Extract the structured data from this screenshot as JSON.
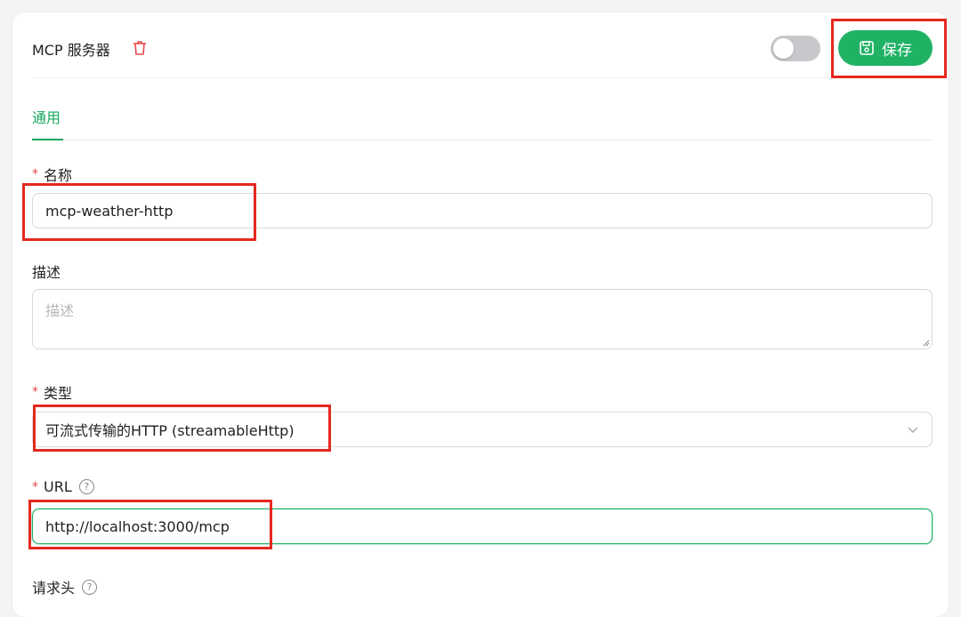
{
  "header": {
    "title": "MCP 服务器",
    "save_label": "保存",
    "enabled": false
  },
  "tabs": [
    {
      "label": "通用",
      "active": true
    }
  ],
  "form": {
    "name": {
      "label": "名称",
      "required": true,
      "value": "mcp-weather-http"
    },
    "description": {
      "label": "描述",
      "placeholder": "描述",
      "value": ""
    },
    "type": {
      "label": "类型",
      "required": true,
      "value": "可流式传输的HTTP (streamableHttp)"
    },
    "url": {
      "label": "URL",
      "required": true,
      "value": "http://localhost:3000/mcp"
    },
    "headers": {
      "label": "请求头"
    }
  },
  "colors": {
    "accent": "#1fb265",
    "required": "#e5484d",
    "highlight": "#e5281f"
  },
  "icons": [
    "trash-icon",
    "toggle-switch",
    "save-icon",
    "help-icon",
    "chevron-down-icon",
    "resize-handle-icon"
  ]
}
